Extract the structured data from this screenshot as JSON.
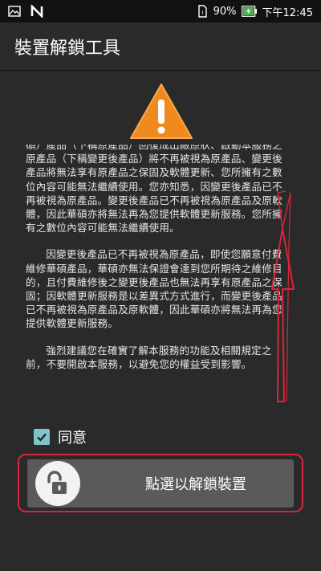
{
  "status_bar": {
    "battery_percent": "90%",
    "time": "下午12:45",
    "icons": [
      "image-icon",
      "n-notification-icon",
      "sim-card-icon",
      "battery-charging-icon"
    ]
  },
  "app_bar": {
    "title": "裝置解鎖工具"
  },
  "content": {
    "warning_icon": "warning-triangle-icon",
    "paragraphs": [
      "碩）產品（下稱原產品）回復成出廠原狀、啟動本服務之原產品（下稱變更後產品）將不再被視為原產品、變更後產品將無法享有原產品之保固及軟體更新、您所擁有之數位內容可能無法繼續使用。您亦知悉，因變更後產品已不再被視為原產品。變更後產品已不再被視為原產品及原軟體，因此華碩亦將無法再為您提供軟體更新服務。您所擁有之數位內容可能無法繼續使用。",
      "因變更後產品已不再被視為原產品，即使您願意付費維修華碩產品，華碩亦無法保證會達到您所期待之維修目的，且付費維修後之變更後產品也無法再享有原產品之保固；因軟體更新服務是以差異式方式進行，而變更後產品已不再被視為原產品及原軟體，因此華碩亦將無法再為您提供軟體更新服務。",
      "強烈建議您在確實了解本服務的功能及相關規定之前，不要開啟本服務，以避免您的權益受到影響。"
    ],
    "agree": {
      "label": "同意",
      "checked": true
    },
    "unlock_button": {
      "label": "點選以解鎖裝置",
      "icon": "unlock-padlock-icon"
    }
  },
  "colors": {
    "accent_teal": "#7fc4c8",
    "warning_orange": "#f08a1e",
    "annotation_red": "#d8263a"
  }
}
